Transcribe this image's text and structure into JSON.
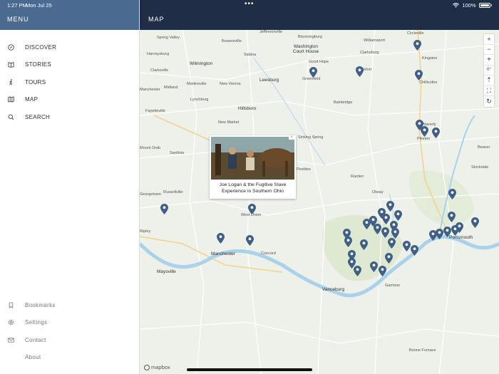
{
  "status_bar": {
    "time": "1:27 PM",
    "date": "Mon Jul 25",
    "battery": "100%"
  },
  "sidebar": {
    "title": "MENU",
    "items": [
      {
        "label": "DISCOVER",
        "icon": "compass-icon"
      },
      {
        "label": "STORIES",
        "icon": "book-icon"
      },
      {
        "label": "TOURS",
        "icon": "walking-icon"
      },
      {
        "label": "MAP",
        "icon": "map-icon"
      },
      {
        "label": "SEARCH",
        "icon": "search-icon"
      }
    ],
    "bottom_items": [
      {
        "label": "Bookmarks",
        "icon": "bookmark-icon"
      },
      {
        "label": "Settings",
        "icon": "gear-icon"
      },
      {
        "label": "Contact",
        "icon": "envelope-icon"
      },
      {
        "label": "About",
        "icon": "info-icon"
      }
    ]
  },
  "header": {
    "title": "MAP"
  },
  "map": {
    "controls": {
      "zoom_in": "+",
      "zoom_out": "−",
      "locate": "⌖",
      "bearing": "0°",
      "compass": "⇡",
      "fullscreen": "⛶",
      "refresh": "↻"
    },
    "popup": {
      "caption": "Joe Logan & the Fugitive Slave Experience in Southern Ohio",
      "close": "×"
    },
    "attribution": "mapbox",
    "places": [
      "Jeffersonville",
      "Bloomingburg",
      "Williamsport",
      "Circleville",
      "Spring Valley",
      "Bowersville",
      "Washington Court House",
      "Clarksburg",
      "Kingston",
      "Harveysburg",
      "Wilmington",
      "Sabina",
      "Good Hope",
      "Frankfort",
      "Clarksville",
      "Greenfield",
      "Chillicothe",
      "Midland",
      "Martinsville",
      "New Vienna",
      "Leesburg",
      "Manchester",
      "Lynchburg",
      "Bainbridge",
      "Hillsboro",
      "Fayetteville",
      "New Market",
      "Sinking Spring",
      "Piketon",
      "Beaver",
      "Mount Orab",
      "Sardinia",
      "Peebles",
      "Stockdale",
      "Rarden",
      "Russellville",
      "Otway",
      "West Union",
      "Ripley",
      "Manchester",
      "Concord",
      "Maysville",
      "Vanceburg",
      "Garrison",
      "Portsmouth",
      "Boone Furnace",
      "Waverly",
      "Georgetown"
    ]
  },
  "colors": {
    "sidebar_header": "#4a6a8f",
    "main_header": "#1f2d47",
    "pin": "#3f5f86",
    "river": "#a9d3ea"
  }
}
